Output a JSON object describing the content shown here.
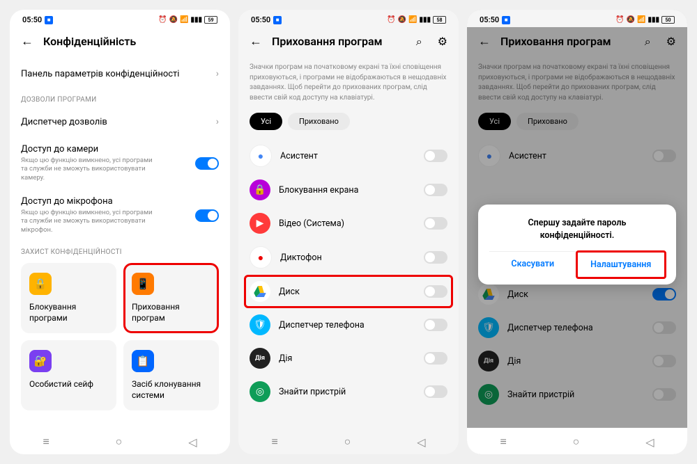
{
  "status": {
    "time": "05:50",
    "battery": {
      "p1": "59",
      "p2": "58",
      "p3": "50"
    }
  },
  "screen1": {
    "title": "Конфіденційність",
    "panel": "Панель параметрів конфіденційності",
    "section_permissions": "ДОЗВОЛИ ПРОГРАМИ",
    "permission_manager": "Диспетчер дозволів",
    "camera": {
      "title": "Доступ до камери",
      "desc": "Якщо цю функцію вимкнено, усі програми та служби не зможуть використовувати камеру."
    },
    "mic": {
      "title": "Доступ до мікрофона",
      "desc": "Якщо цю функцію вимкнено, усі програми та служби не зможуть використовувати мікрофон."
    },
    "section_privacy": "ЗАХИСТ КОНФІДЕНЦІЙНОСТІ",
    "cards": {
      "lock": "Блокування\nпрограми",
      "hide": "Приховання\nпрограм",
      "safe": "Особистий сейф",
      "clone": "Засіб клонування\nсистеми"
    }
  },
  "screen2": {
    "title": "Приховання програм",
    "info": "Значки програм на початковому екрані та їхні сповіщення приховуються, і програми не відображаються в нещодавніх завданнях. Щоб перейти до прихованих програм, слід ввести свій код доступу на клавіатурі.",
    "filter_all": "Усі",
    "filter_hidden": "Приховано",
    "apps": [
      "Асистент",
      "Блокування екрана",
      "Відео (Система)",
      "Диктофон",
      "Диск",
      "Диспетчер телефона",
      "Дія",
      "Знайти пристрій"
    ]
  },
  "screen3": {
    "dialog": {
      "text": "Спершу задайте пароль конфіденційності.",
      "cancel": "Скасувати",
      "settings": "Налаштування"
    }
  }
}
